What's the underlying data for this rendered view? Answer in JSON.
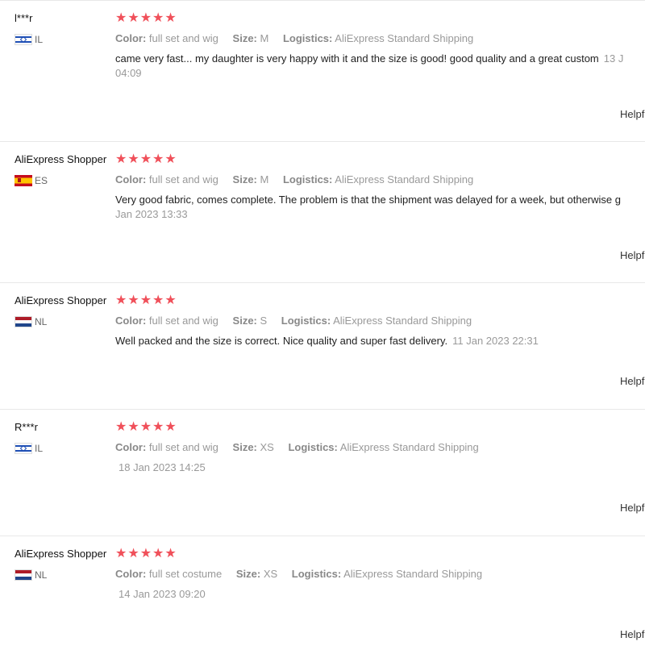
{
  "reviews": [
    {
      "user": "l***r",
      "country": "IL",
      "flag": "IL",
      "stars": "★★★★★",
      "color_label": "Color:",
      "color_value": "full set and wig",
      "size_label": "Size:",
      "size_value": "M",
      "logistics_label": "Logistics:",
      "logistics_value": "AliExpress Standard Shipping",
      "text": "came very fast... my daughter is very happy with it and the size is good! good quality and a great custom",
      "date": "13 J",
      "date_cont": "04:09",
      "helpful": "Helpf"
    },
    {
      "user": "AliExpress Shopper",
      "country": "ES",
      "flag": "ES",
      "stars": "★★★★★",
      "color_label": "Color:",
      "color_value": "full set and wig",
      "size_label": "Size:",
      "size_value": "M",
      "logistics_label": "Logistics:",
      "logistics_value": "AliExpress Standard Shipping",
      "text": "Very good fabric, comes complete. The problem is that the shipment was delayed for a week, but otherwise g",
      "date": "Jan 2023 13:33",
      "helpful": "Helpf"
    },
    {
      "user": "AliExpress Shopper",
      "country": "NL",
      "flag": "NL",
      "stars": "★★★★★",
      "color_label": "Color:",
      "color_value": "full set and wig",
      "size_label": "Size:",
      "size_value": "S",
      "logistics_label": "Logistics:",
      "logistics_value": "AliExpress Standard Shipping",
      "text": "Well packed and the size is correct. Nice quality and super fast delivery.",
      "date": "11 Jan 2023 22:31",
      "helpful": "Helpf"
    },
    {
      "user": "R***r",
      "country": "IL",
      "flag": "IL",
      "stars": "★★★★★",
      "color_label": "Color:",
      "color_value": "full set and wig",
      "size_label": "Size:",
      "size_value": "XS",
      "logistics_label": "Logistics:",
      "logistics_value": "AliExpress Standard Shipping",
      "date": "18 Jan 2023 14:25",
      "helpful": "Helpf"
    },
    {
      "user": "AliExpress Shopper",
      "country": "NL",
      "flag": "NL",
      "stars": "★★★★★",
      "color_label": "Color:",
      "color_value": "full set costume",
      "size_label": "Size:",
      "size_value": "XS",
      "logistics_label": "Logistics:",
      "logistics_value": "AliExpress Standard Shipping",
      "date": "14 Jan 2023 09:20",
      "helpful": "Helpf"
    }
  ],
  "colors": {
    "star": "#f0505a",
    "muted": "#999999",
    "divider": "#e8e8e8"
  }
}
